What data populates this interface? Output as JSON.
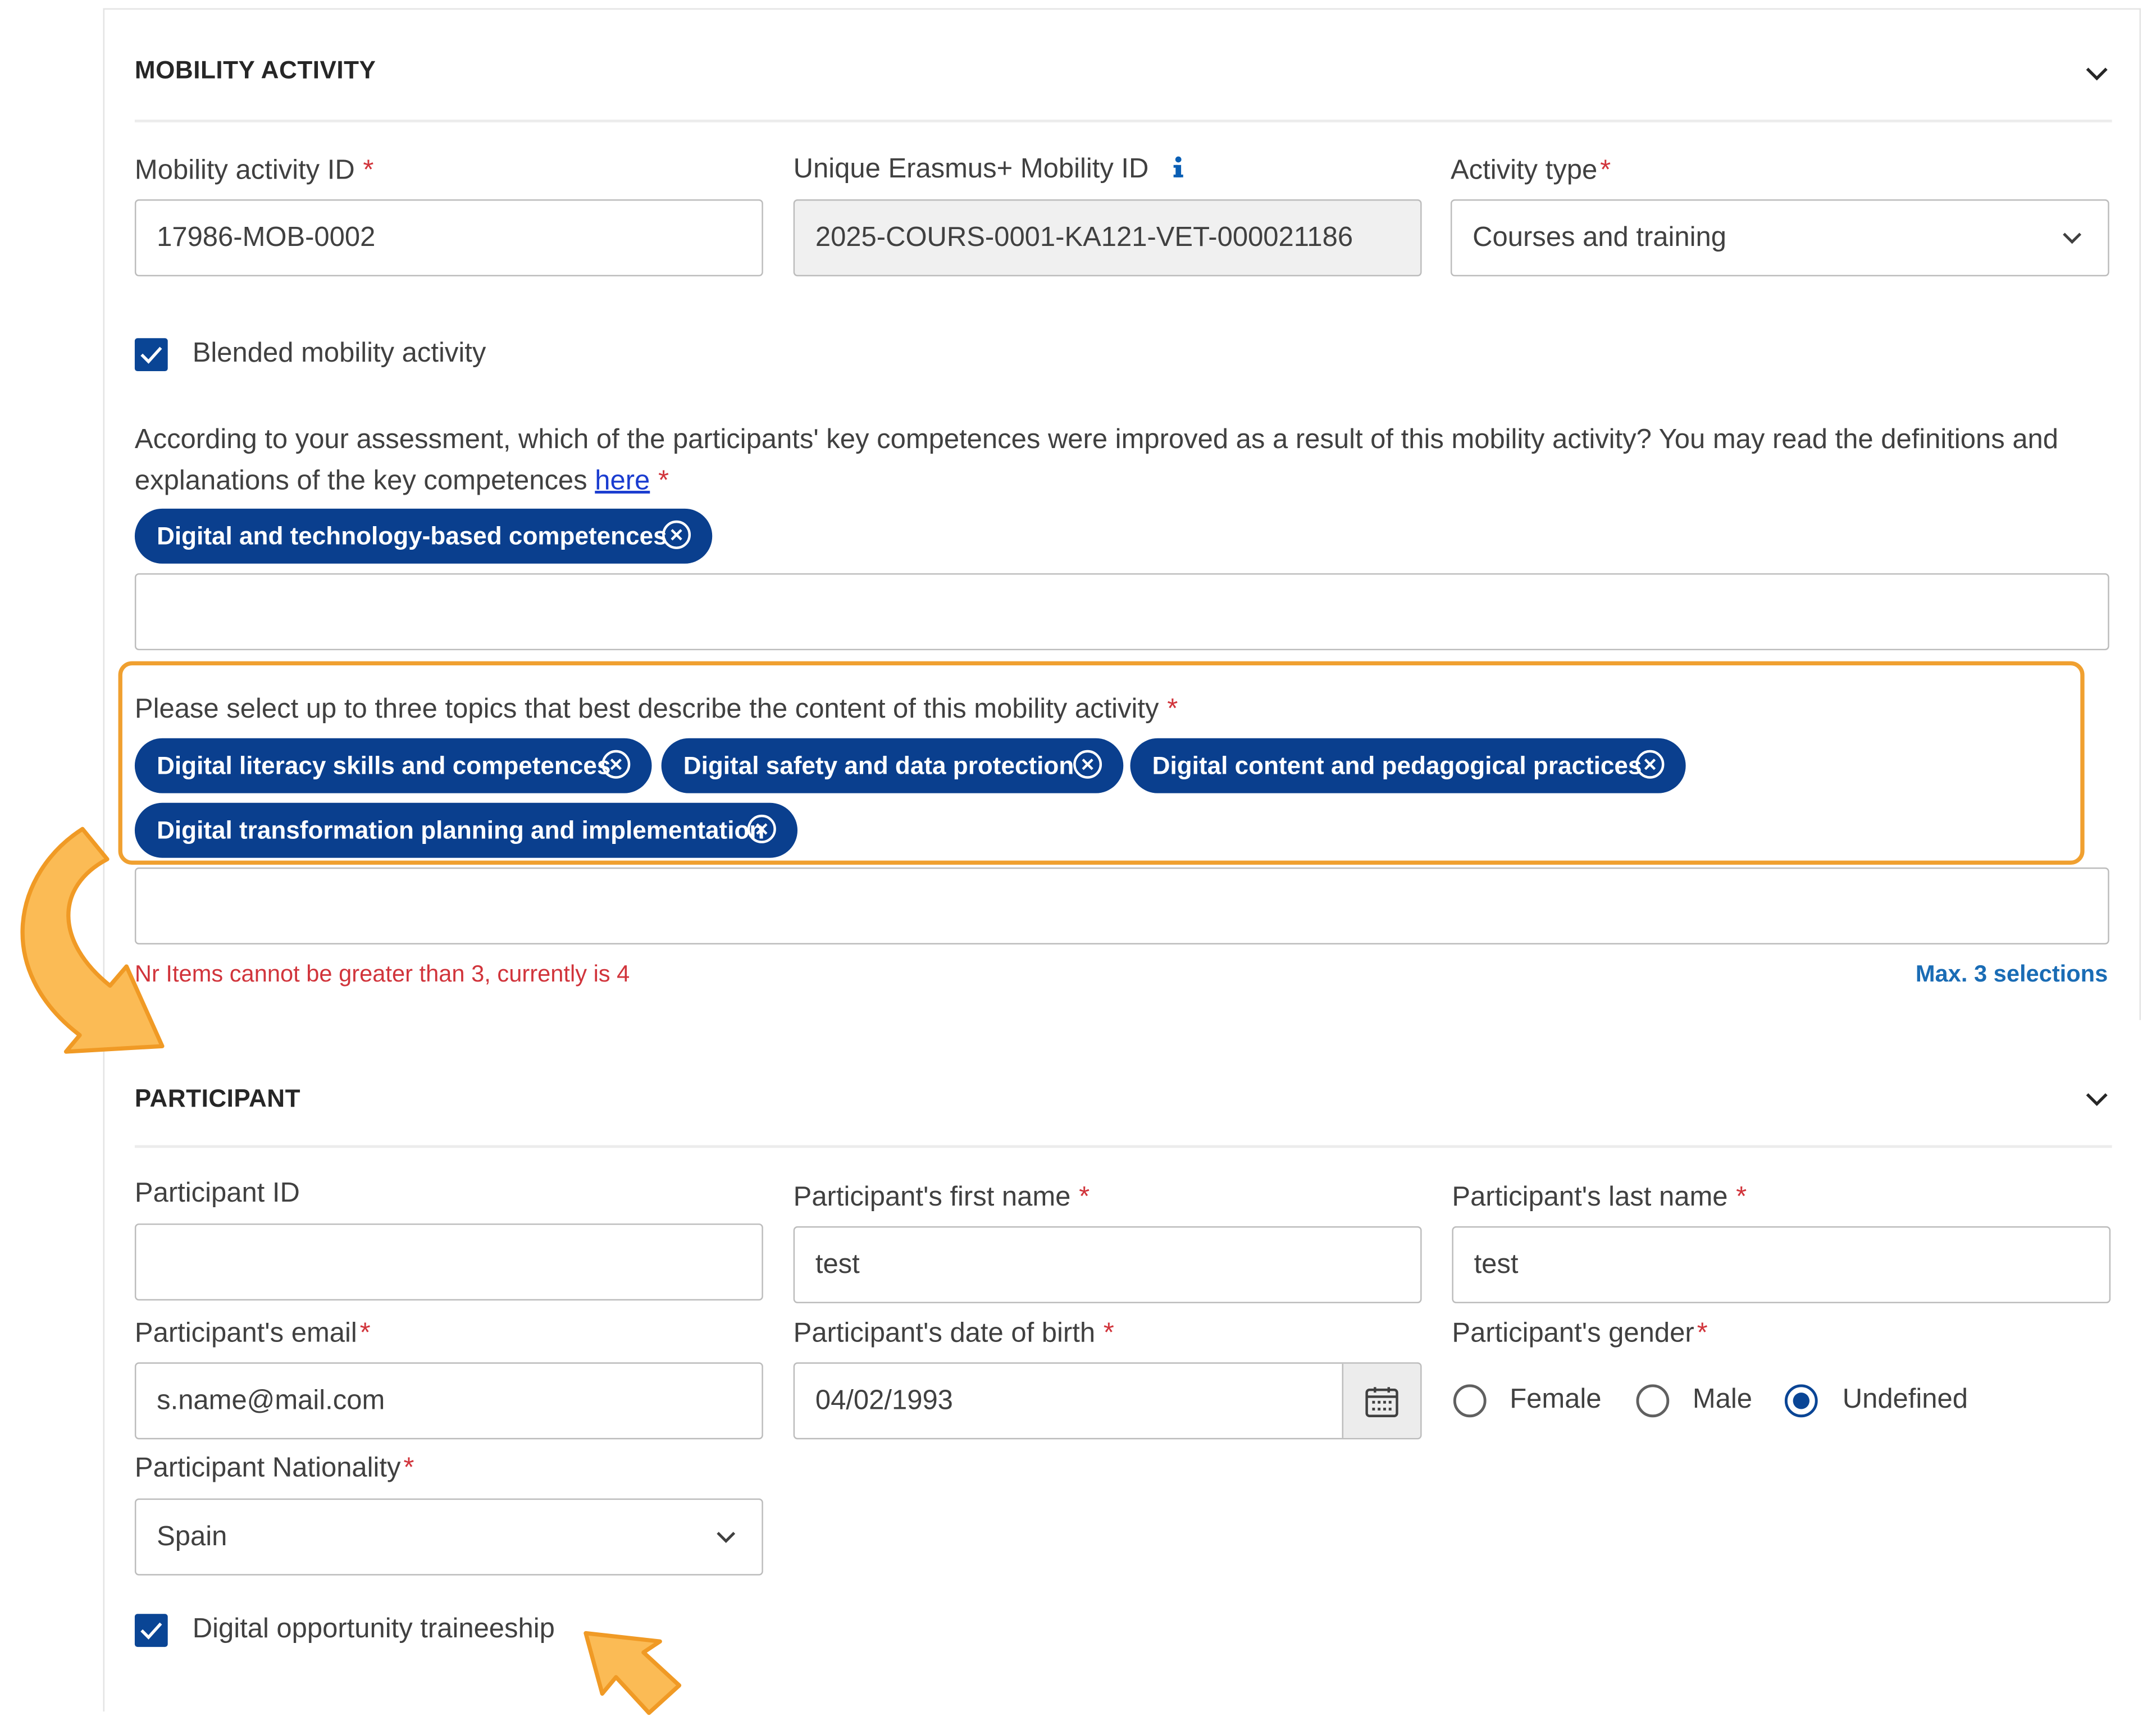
{
  "mobility": {
    "section_title": "MOBILITY ACTIVITY",
    "activity_id_label": "Mobility activity ID",
    "activity_id_value": "17986-MOB-0002",
    "unique_id_label": "Unique Erasmus+ Mobility ID",
    "unique_id_value": "2025-COURS-0001-KA121-VET-000021186",
    "activity_type_label": "Activity type",
    "activity_type_value": "Courses and training",
    "blended_label": "Blended mobility activity",
    "blended_checked": true,
    "competences_question_part1": "According to your assessment, which of the participants' key competences were improved as a result of this mobility activity? You may read the definitions and explanations of the key competences",
    "competences_link": "here",
    "competence_chips": [
      "Digital and technology-based competences"
    ],
    "topics_question": "Please select up to three topics that best describe the content of this mobility activity",
    "topic_chips": [
      "Digital literacy skills and competences",
      "Digital safety and data protection",
      "Digital content and pedagogical practices",
      "Digital transformation planning and implementation"
    ],
    "topics_error": "Nr Items cannot be greater than 3, currently is 4",
    "topics_hint": "Max. 3 selections",
    "required_mark": "*"
  },
  "participant": {
    "section_title": "PARTICIPANT",
    "id_label": "Participant ID",
    "id_value": "",
    "first_name_label": "Participant's first name",
    "first_name_value": "test",
    "last_name_label": "Participant's last name",
    "last_name_value": "test",
    "email_label": "Participant's email",
    "email_value": "s.name@mail.com",
    "dob_label": "Participant's date of birth",
    "dob_value": "04/02/1993",
    "gender_label": "Participant's gender",
    "gender_options": [
      "Female",
      "Male",
      "Undefined"
    ],
    "gender_selected": "Undefined",
    "nationality_label": "Participant Nationality",
    "nationality_value": "Spain",
    "traineeship_label": "Digital opportunity traineeship",
    "traineeship_checked": true
  },
  "colors": {
    "chip": "#0a3f8e",
    "checkbox": "#0a4595",
    "required": "#d1343b",
    "hint": "#1a6cb5",
    "highlight": "#f0a030"
  }
}
